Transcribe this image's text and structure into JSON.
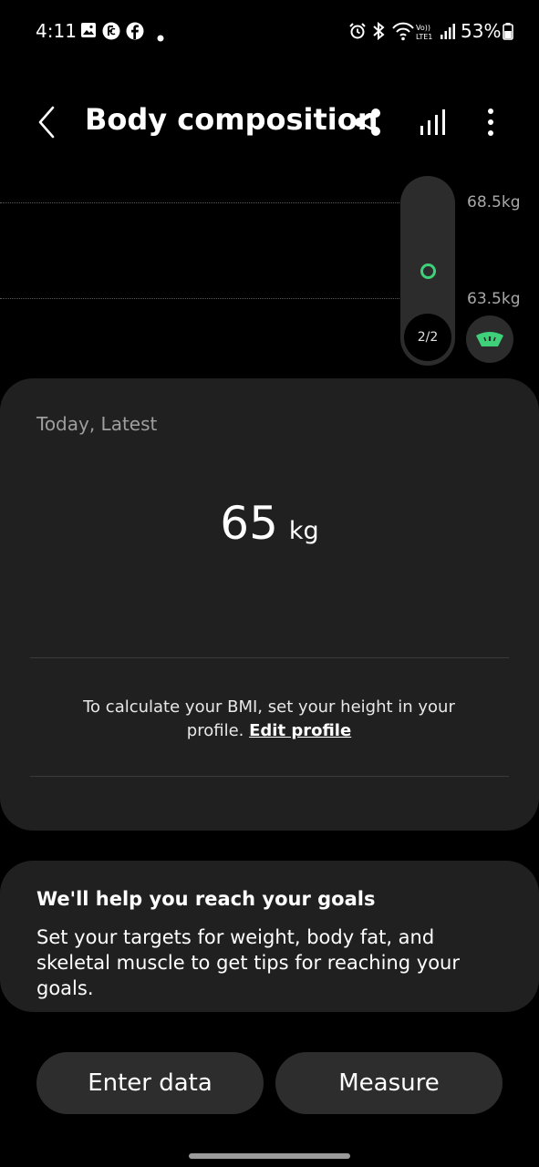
{
  "status_bar": {
    "time": "4:11",
    "battery": "53%",
    "icons_left": [
      "gallery-icon",
      "app-notification-icon",
      "facebook-icon",
      "dot-icon"
    ],
    "icons_right": [
      "alarm-icon",
      "bluetooth-icon",
      "wifi-calling-icon",
      "signal-icon",
      "battery-icon"
    ],
    "volte_text": "Vo)) LTE1"
  },
  "header": {
    "title": "Body composition",
    "actions": [
      "back-icon",
      "share-icon",
      "chart-icon",
      "more-icon"
    ]
  },
  "chart": {
    "upper_label": "68.5kg",
    "lower_label": "63.5kg",
    "page_indicator": "2/2",
    "point_value_kg": 65,
    "point_color": "#3fd17a"
  },
  "result": {
    "date_label": "Today, Latest",
    "weight": "65",
    "unit": "kg",
    "bmi_note": "To calculate your BMI, set your height in your profile.",
    "edit_link": "Edit profile"
  },
  "goals": {
    "title": "We'll help you reach your goals",
    "body": "Set your targets for weight, body fat, and skeletal muscle to get tips for reaching your goals."
  },
  "buttons": {
    "enter_data": "Enter data",
    "measure": "Measure"
  },
  "colors": {
    "background": "#000000",
    "card": "#202020",
    "accent_green": "#3fd17a"
  }
}
